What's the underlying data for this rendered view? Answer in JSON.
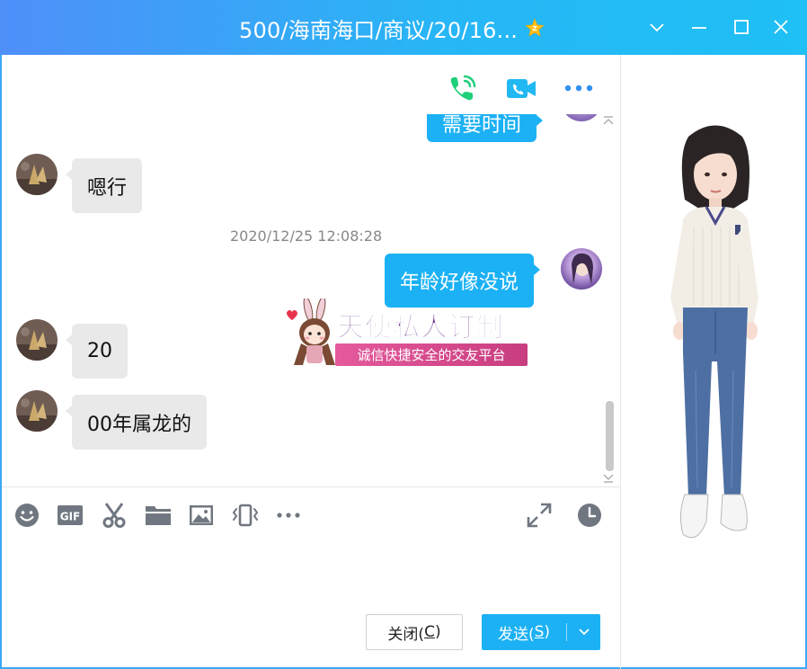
{
  "window": {
    "title": "500/海南海口/商议/20/16..."
  },
  "chat": {
    "messages": [
      {
        "side": "out",
        "text": "需要时间"
      },
      {
        "side": "in",
        "text": "嗯行"
      },
      {
        "side": "out",
        "text": "年龄好像没说"
      },
      {
        "side": "in",
        "text": "20"
      },
      {
        "side": "in",
        "text": "00年属龙的"
      }
    ],
    "timestamp": "2020/12/25 12:08:28"
  },
  "ad": {
    "title": "天使私人订制",
    "subtitle": "诚信快捷安全的交友平台"
  },
  "buttons": {
    "close_label": "关闭(",
    "close_key": "C",
    "close_end": ")",
    "send_label": "发送(",
    "send_key": "S",
    "send_end": ")"
  },
  "icons": {
    "top": [
      "phone-icon",
      "video-call-icon",
      "more-icon"
    ],
    "toolbar": [
      "emoji-icon",
      "gif-icon",
      "screenshot-scissors-icon",
      "folder-icon",
      "image-icon",
      "shake-icon",
      "more-icon",
      "expand-icon",
      "history-clock-icon"
    ]
  },
  "colors": {
    "accent": "#1cb1f4",
    "titlebar_start": "#4f8ff9",
    "titlebar_end": "#1ec0f5",
    "bubble_in": "#e9e9e9",
    "phone_green": "#1fcf7a"
  }
}
